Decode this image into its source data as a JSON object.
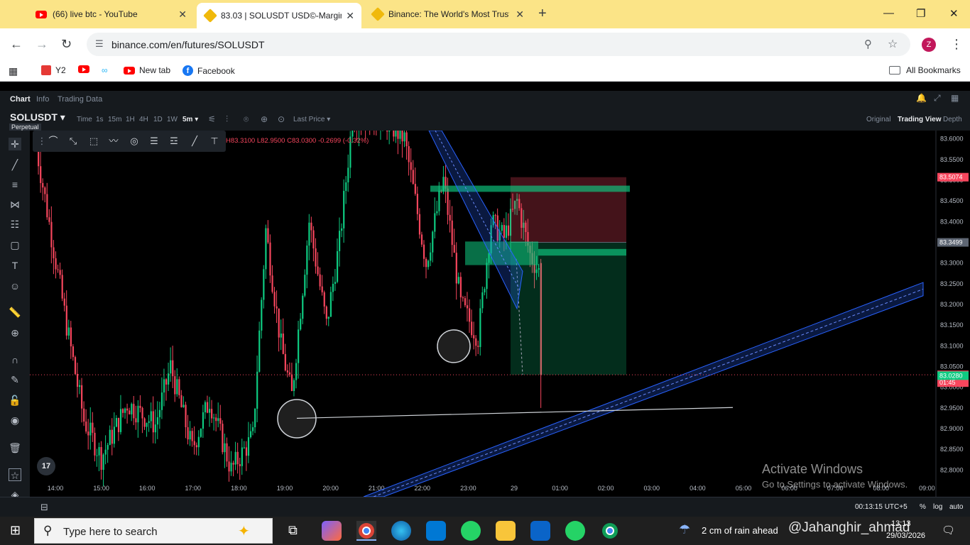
{
  "browser": {
    "tabs": [
      {
        "title": "(66) live btc - YouTube",
        "active": false
      },
      {
        "title": "83.03 | SOLUSDT USD©-Margin",
        "active": true
      },
      {
        "title": "Binance: The World's Most Trust",
        "active": false
      }
    ],
    "url": "binance.com/en/futures/SOLUSDT",
    "profile_initial": "Z",
    "bookmarks": [
      "Y2",
      "New tab",
      "Facebook"
    ],
    "all_bookmarks": "All Bookmarks"
  },
  "app": {
    "subtabs": [
      "Chart",
      "Info",
      "Trading Data"
    ],
    "symbol": "SOLUSDT",
    "contract": "Perpetual",
    "intervals": [
      "Time",
      "1s",
      "15m",
      "1H",
      "4H",
      "1D",
      "1W",
      "5m"
    ],
    "active_interval": "5m",
    "price_type": "Last Price",
    "views": [
      "Original",
      "Trading View",
      "Depth"
    ],
    "active_view": "Trading View",
    "ohlc": "H83.3100  L82.9500  C83.0300  -0.2699 (-0.32%)",
    "clock": "00:13:15 UTC+5",
    "axis_opts": [
      "%",
      "log",
      "auto"
    ],
    "current_price_countdown": "01:45",
    "tv_logo": "17"
  },
  "chart_data": {
    "type": "candlestick",
    "y_ticks": [
      83.6,
      83.55,
      83.5,
      83.45,
      83.4,
      83.35,
      83.3,
      83.25,
      83.2,
      83.15,
      83.1,
      83.05,
      83.0,
      82.95,
      82.9,
      82.85,
      82.8
    ],
    "y_tick_labels": [
      "83.6000",
      "83.5500",
      "83.5000",
      "83.4500",
      "83.4000",
      "83.3500",
      "83.3000",
      "83.2500",
      "83.2000",
      "83.1500",
      "83.1000",
      "83.0500",
      "83.0000",
      "82.9500",
      "82.9000",
      "82.8500",
      "82.8000"
    ],
    "x_ticks": [
      "14:00",
      "15:00",
      "16:00",
      "17:00",
      "18:00",
      "19:00",
      "20:00",
      "21:00",
      "22:00",
      "23:00",
      "29",
      "01:00",
      "02:00",
      "03:00",
      "04:00",
      "05:00",
      "06:00",
      "07:00",
      "08:00",
      "09:00"
    ],
    "price_labels": [
      {
        "value": 83.5074,
        "text": "83.5074",
        "color": "#f6465d"
      },
      {
        "value": 83.3499,
        "text": "83.3499",
        "color": "#5e6673"
      },
      {
        "value": 83.03,
        "text": "83.0300",
        "color": "#f6465d"
      },
      {
        "value": 83.028,
        "text": "83.0280",
        "color": "#0ecb81"
      }
    ],
    "ylim": [
      82.78,
      83.62
    ],
    "colors": {
      "up": "#0ecb81",
      "down": "#f6465d",
      "channel": "#2962ff"
    }
  },
  "taskbar": {
    "search_placeholder": "Type here to search",
    "weather": "2 cm of rain ahead",
    "watermark_name": "@Jahanghir_ahmad",
    "time": "13:13",
    "date": "29/03/2026"
  },
  "watermark": {
    "line1": "Activate Windows",
    "line2": "Go to Settings to activate Windows."
  }
}
